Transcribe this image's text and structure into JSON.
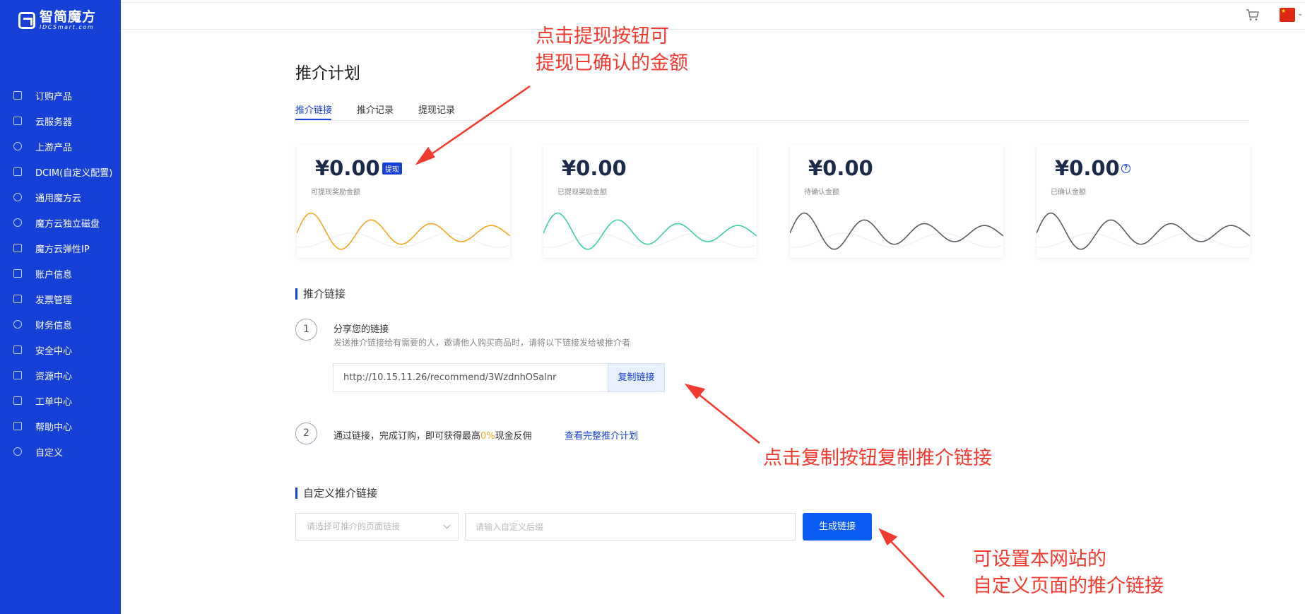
{
  "brand": {
    "name": "智简魔方",
    "sub": "IDCSmart.com"
  },
  "sidebar": {
    "items": [
      {
        "label": "订购产品",
        "icon": "cart-icon"
      },
      {
        "label": "云服务器",
        "icon": "server-icon"
      },
      {
        "label": "上游产品",
        "icon": "upstream-icon"
      },
      {
        "label": "DCIM(自定义配置)",
        "icon": "dcim-icon"
      },
      {
        "label": "通用魔方云",
        "icon": "cloud-icon"
      },
      {
        "label": "魔方云独立磁盘",
        "icon": "disk-icon"
      },
      {
        "label": "魔方云弹性IP",
        "icon": "elastic-ip-icon"
      },
      {
        "label": "账户信息",
        "icon": "account-icon"
      },
      {
        "label": "发票管理",
        "icon": "invoice-icon"
      },
      {
        "label": "财务信息",
        "icon": "finance-icon"
      },
      {
        "label": "安全中心",
        "icon": "lock-icon"
      },
      {
        "label": "资源中心",
        "icon": "tag-icon"
      },
      {
        "label": "工单中心",
        "icon": "ticket-icon"
      },
      {
        "label": "帮助中心",
        "icon": "help-icon"
      },
      {
        "label": "自定义",
        "icon": "custom-icon"
      }
    ]
  },
  "header": {
    "cart_icon": "cart-icon",
    "language_flag": "china-flag-icon"
  },
  "main": {
    "title": "推介计划",
    "tabs": [
      {
        "label": "推介链接",
        "active": true
      },
      {
        "label": "推介记录",
        "active": false
      },
      {
        "label": "提现记录",
        "active": false
      }
    ],
    "cards": [
      {
        "amount": "¥0.00",
        "label": "可提现奖励金额",
        "badge": "提现",
        "color": "#f5a623"
      },
      {
        "amount": "¥0.00",
        "label": "已提现奖励金额",
        "color": "#3fd0a4"
      },
      {
        "amount": "¥0.00",
        "label": "待确认金额",
        "color": "#5b5b66"
      },
      {
        "amount": "¥0.00",
        "label": "已确认金额",
        "help": "?",
        "color": "#5b5b66"
      }
    ],
    "referral": {
      "section_title": "推介链接",
      "step1": {
        "num": "1",
        "title": "分享您的链接",
        "desc": "发送推介链接给有需要的人，邀请他人购买商品时，请将以下链接发给被推介者"
      },
      "link": "http://10.15.11.26/recommend/3WzdnhOSalnr",
      "copy_label": "复制链接",
      "step2": {
        "num": "2",
        "text_before": "通过链接，完成订购，即可获得最高",
        "percent": "0%",
        "text_after": "现金反佣",
        "link": "查看完整推介计划"
      }
    },
    "custom": {
      "section_title": "自定义推介链接",
      "select_placeholder": "请选择可推介的页面链接",
      "input_placeholder": "请输入自定义后缀",
      "generate_label": "生成链接"
    }
  },
  "annotations": {
    "withdraw_note": [
      "点击提现按钮可",
      "提现已确认的金额"
    ],
    "copy_note": "点击复制按钮复制推介链接",
    "custom_note": [
      "可设置本网站的",
      "自定义页面的推介链接"
    ],
    "color": "#f23a2f"
  }
}
